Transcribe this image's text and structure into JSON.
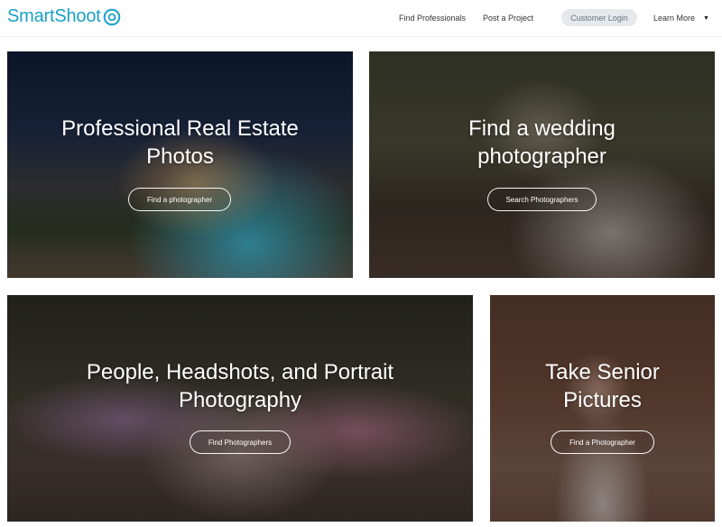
{
  "header": {
    "logo_text": "SmartShoot",
    "logo_icon": "camera-lens-icon",
    "nav": {
      "find_professionals": "Find Professionals",
      "post_project": "Post a Project",
      "customer_login": "Customer Login",
      "learn_more": "Learn More",
      "learn_more_caret": "▼"
    }
  },
  "cards": [
    {
      "title_line1": "Professional Real Estate",
      "title_line2": "Photos",
      "button": "Find a photographer"
    },
    {
      "title_line1": "Find a wedding",
      "title_line2": "photographer",
      "button": "Search Photographers"
    },
    {
      "title_line1": "People, Headshots, and Portrait",
      "title_line2": "Photography",
      "button": "Find Photographers"
    },
    {
      "title_line1": "Take Senior",
      "title_line2": "Pictures",
      "button": "Find a Photographer"
    }
  ],
  "colors": {
    "brand": "#1aa0c6",
    "login_bg": "#e5e8ec"
  }
}
